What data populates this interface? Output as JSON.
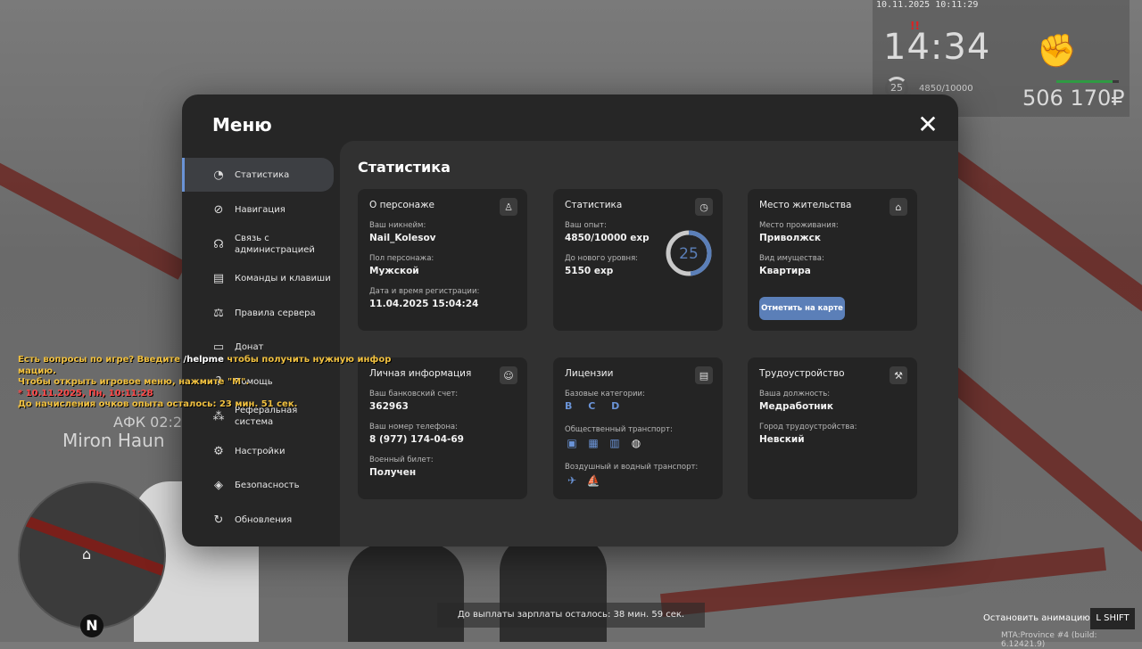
{
  "hud": {
    "datetime": "10.11.2025 10:11:29",
    "wanted": "!!",
    "time": "14:34",
    "level": "25",
    "exp": "4850/10000",
    "money": "506 170₽",
    "bar_fraction": 0.9
  },
  "chat": {
    "line1_pre": "Есть вопросы по игре? Введите ",
    "line1_cmd": "/helpme",
    "line1_post": " чтобы получить нужную инфор",
    "line2": "мацию.",
    "line3": "Чтобы открыть игровое меню, нажмите \"M\".",
    "line4": "* 10.11.2025, Пн, 10:11:28",
    "line5": "До начисления очков опыта осталось: 23 мин. 51 сек."
  },
  "world": {
    "afk": "АФК 02:2",
    "player": "Miron Haun",
    "compass": "N"
  },
  "bottom": {
    "payday": "До выплаты зарплаты осталось: 38 мин. 59 сек.",
    "stop_anim": "Остановить анимацию",
    "key": "L SHIFT",
    "build": "MTA:Province #4 (build: 6.12421.9)"
  },
  "menu": {
    "title": "Меню",
    "close": "✕",
    "sidebar": [
      {
        "label": "Статистика",
        "icon": "pie-icon",
        "glyph": "◔"
      },
      {
        "label": "Навигация",
        "icon": "compass-icon",
        "glyph": "⊘"
      },
      {
        "label": "Связь с\nадминистрацией",
        "icon": "headset-icon",
        "glyph": "☊"
      },
      {
        "label": "Команды и клавиши",
        "icon": "document-icon",
        "glyph": "▤"
      },
      {
        "label": "Правила сервера",
        "icon": "scales-icon",
        "glyph": "⚖"
      },
      {
        "label": "Донат",
        "icon": "wallet-icon",
        "glyph": "▭"
      },
      {
        "label": "Помощь",
        "icon": "help-icon",
        "glyph": "?"
      },
      {
        "label": "Реферальная\nсистема",
        "icon": "share-icon",
        "glyph": "⁂"
      },
      {
        "label": "Настройки",
        "icon": "gear-icon",
        "glyph": "⚙"
      },
      {
        "label": "Безопасность",
        "icon": "shield-icon",
        "glyph": "◈"
      },
      {
        "label": "Обновления",
        "icon": "refresh-icon",
        "glyph": "↻"
      }
    ],
    "content_title": "Статистика",
    "cards": {
      "person": {
        "title": "О персонаже",
        "nick_label": "Ваш никнейм:",
        "nick": "Nail_Kolesov",
        "sex_label": "Пол персонажа:",
        "sex": "Мужской",
        "reg_label": "Дата и время регистрации:",
        "reg": "11.04.2025 15:04:24"
      },
      "stats": {
        "title": "Статистика",
        "exp_label": "Ваш опыт:",
        "exp": "4850/10000 exp",
        "next_label": "До нового уровня:",
        "next": "5150 exp",
        "level": "25",
        "progress": 0.485
      },
      "home": {
        "title": "Место жительства",
        "place_label": "Место проживания:",
        "place": "Приволжск",
        "prop_label": "Вид имущества:",
        "prop": "Квартира",
        "button": "Отметить на карте"
      },
      "personal": {
        "title": "Личная информация",
        "bank_label": "Ваш банковский счет:",
        "bank": "362963",
        "phone_label": "Ваш номер телефона:",
        "phone": "8 (977) 174-04-69",
        "military_label": "Военный билет:",
        "military": "Получен"
      },
      "licenses": {
        "title": "Лицензии",
        "base_label": "Базовые категории:",
        "base": "B C D",
        "public_label": "Общественный транспорт:",
        "air_label": "Воздушный и водный транспорт:"
      },
      "job": {
        "title": "Трудоустройство",
        "pos_label": "Ваша должность:",
        "pos": "Медработник",
        "city_label": "Город трудоустройства:",
        "city": "Невский"
      }
    }
  }
}
